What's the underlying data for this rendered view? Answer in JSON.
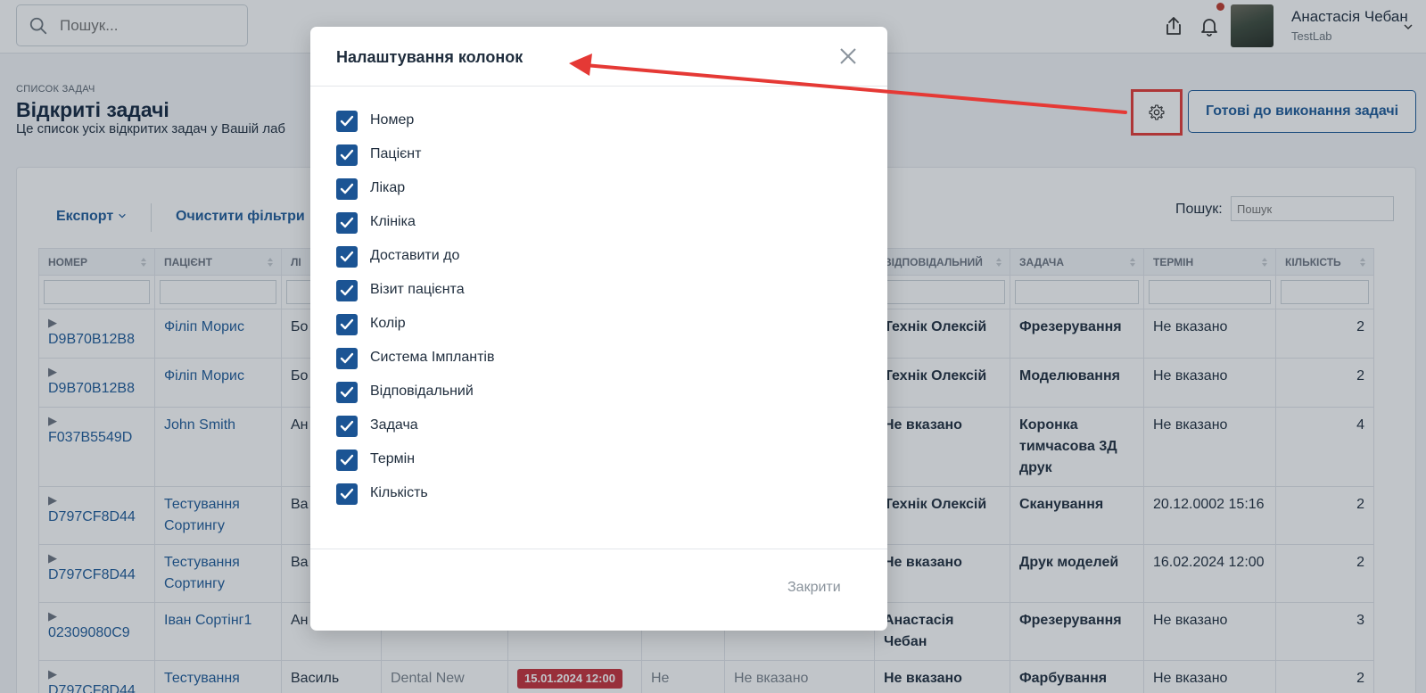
{
  "header": {
    "search_placeholder": "Пошук...",
    "user_name": "Анастасія Чебан",
    "user_org": "TestLab",
    "icons": [
      "search-icon",
      "share-icon",
      "bell-icon",
      "chevron-down-icon"
    ]
  },
  "page": {
    "breadcrumb": "Список задач",
    "title": "Відкриті задачі",
    "subtitle": "Це список усіх відкритих задач у Вашій лаб",
    "ready_button": "Готові до виконання задачі",
    "settings_icon": "gear-icon"
  },
  "toolbar": {
    "export_label": "Експорт",
    "clear_filters_label": "Очистити фільтри",
    "search_label": "Пошук:",
    "search_placeholder": "Пошук"
  },
  "table": {
    "columns": [
      "Номер",
      "Пацієнт",
      "Лі",
      "",
      "",
      "",
      "",
      "Відповідальний",
      "Задача",
      "Термін",
      "Кількість"
    ],
    "rows": [
      {
        "number": "D9B70B12B8",
        "patient": "Філіп Морис",
        "doctor": "Бо Хр",
        "clinic": "",
        "deliver": "",
        "visit": "",
        "color": "",
        "responsible": "Технік Олексій",
        "task": "Фрезерування",
        "deadline": "Не вказано",
        "qty": "2"
      },
      {
        "number": "D9B70B12B8",
        "patient": "Філіп Морис",
        "doctor": "Бо Хр",
        "clinic": "",
        "deliver": "",
        "visit": "",
        "color": "",
        "responsible": "Технік Олексій",
        "task": "Моделювання",
        "deadline": "Не вказано",
        "qty": "2"
      },
      {
        "number": "F037B5549D",
        "patient": "John Smith",
        "doctor": "Ан",
        "clinic": "",
        "deliver": "",
        "visit": "",
        "color": "",
        "responsible": "Не вказано",
        "task": "Коронка тимчасова 3Д друк",
        "deadline": "Не вказано",
        "qty": "4"
      },
      {
        "number": "D797CF8D44",
        "patient": "Тестування Сортингу",
        "doctor": "Ва Пе",
        "clinic": "",
        "deliver": "",
        "visit": "",
        "color": "",
        "responsible": "Технік Олексій",
        "task": "Сканування",
        "deadline": "20.12.0002 15:16",
        "qty": "2"
      },
      {
        "number": "D797CF8D44",
        "patient": "Тестування Сортингу",
        "doctor": "Ва Пе",
        "clinic": "",
        "deliver": "",
        "visit": "",
        "color": "",
        "responsible": "Не вказано",
        "task": "Друк моделей",
        "deadline": "16.02.2024 12:00",
        "qty": "2"
      },
      {
        "number": "02309080C9",
        "patient": "Іван Сортінг1",
        "doctor": "Ан",
        "clinic": "",
        "deliver": "",
        "visit": "",
        "color": "",
        "responsible": "Анастасія Чебан",
        "task": "Фрезерування",
        "deadline": "Не вказано",
        "qty": "3"
      },
      {
        "number": "D797CF8D44",
        "patient": "Тестування Сортингу",
        "doctor": "Василь Петрович",
        "clinic": "Dental New",
        "deliver": "15.01.2024 12:00",
        "visit": "Не вказано",
        "color": "Не вказано",
        "responsible": "Не вказано",
        "task": "Фарбування",
        "deadline": "Не вказано",
        "qty": "2"
      }
    ]
  },
  "modal": {
    "title": "Налаштування колонок",
    "options": [
      {
        "label": "Номер",
        "checked": true
      },
      {
        "label": "Пацієнт",
        "checked": true
      },
      {
        "label": "Лікар",
        "checked": true
      },
      {
        "label": "Клініка",
        "checked": true
      },
      {
        "label": "Доставити до",
        "checked": true
      },
      {
        "label": "Візит пацієнта",
        "checked": true
      },
      {
        "label": "Колір",
        "checked": true
      },
      {
        "label": "Система Імплантів",
        "checked": true
      },
      {
        "label": "Відповідальний",
        "checked": true
      },
      {
        "label": "Задача",
        "checked": true
      },
      {
        "label": "Термін",
        "checked": true
      },
      {
        "label": "Кількість",
        "checked": true
      }
    ],
    "close_label": "Закрити"
  },
  "colors": {
    "accent": "#1e5a99",
    "checkbox": "#1b5494",
    "badge_red": "#c7303a",
    "annotation_red": "#e53935"
  }
}
